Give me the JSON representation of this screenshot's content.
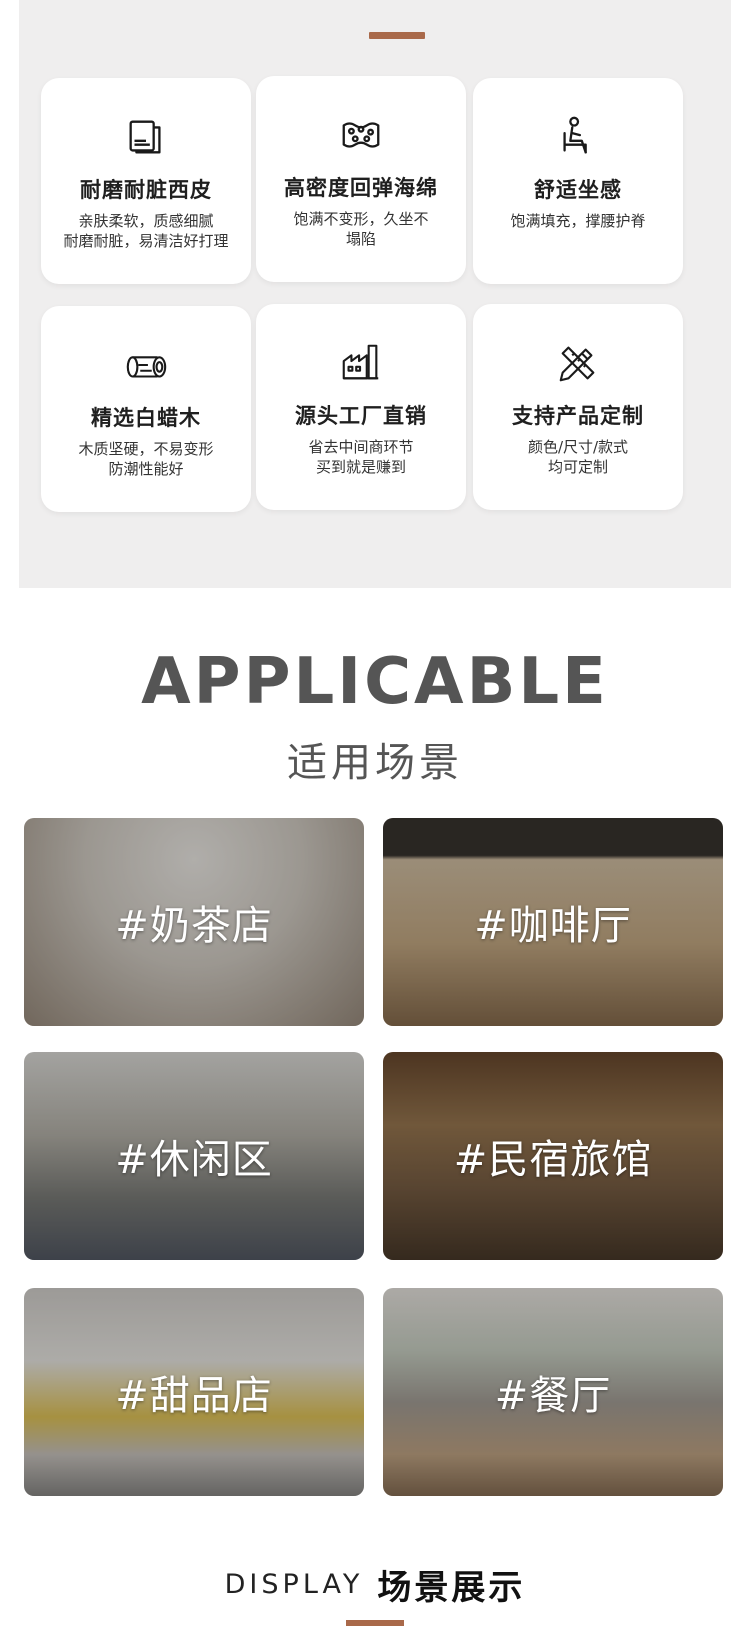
{
  "accent_color": "#a9694a",
  "features": [
    {
      "icon": "leather-swatch-icon",
      "title": "耐磨耐脏西皮",
      "desc": "亲肤柔软，质感细腻\n耐磨耐脏，易清洁好打理"
    },
    {
      "icon": "sponge-icon",
      "title": "高密度回弹海绵",
      "desc": "饱满不变形，久坐不\n塌陷"
    },
    {
      "icon": "seated-person-icon",
      "title": "舒适坐感",
      "desc": "饱满填充，撑腰护脊"
    },
    {
      "icon": "wood-log-icon",
      "title": "精选白蜡木",
      "desc": "木质坚硬，不易变形\n防潮性能好"
    },
    {
      "icon": "factory-icon",
      "title": "源头工厂直销",
      "desc": "省去中间商环节\n买到就是赚到"
    },
    {
      "icon": "pencil-ruler-icon",
      "title": "支持产品定制",
      "desc": "颜色/尺寸/款式\n均可定制"
    }
  ],
  "applicable": {
    "title": "APPLICABLE",
    "subtitle": "适用场景",
    "scenes": [
      {
        "label": "#奶茶店"
      },
      {
        "label": "#咖啡厅"
      },
      {
        "label": "#休闲区"
      },
      {
        "label": "#民宿旅馆"
      },
      {
        "label": "#甜品店"
      },
      {
        "label": "#餐厅"
      }
    ]
  },
  "display": {
    "en": "DISPLAY",
    "cn": "场景展示"
  }
}
